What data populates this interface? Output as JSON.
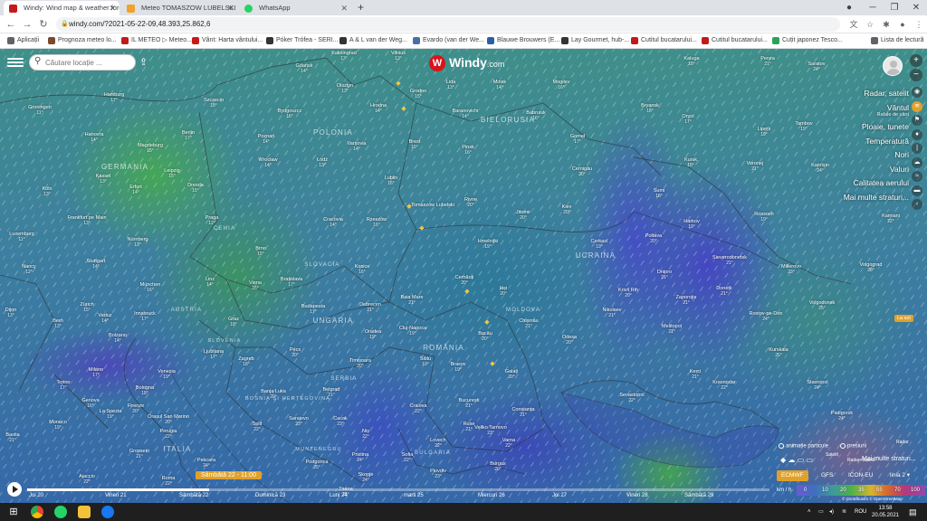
{
  "browser": {
    "tabs": [
      {
        "title": "Windy: Wind map & weather fore",
        "active": true,
        "favicon_color": "#c41a1a"
      },
      {
        "title": "Meteo TOMASZOW LUBELSKI (P",
        "active": false,
        "favicon_color": "#f0a22a"
      },
      {
        "title": "WhatsApp",
        "active": false,
        "favicon_color": "#25d366"
      }
    ],
    "new_tab_label": "+",
    "url": "windy.com/?2021-05-22-09,48.393,25.862,6",
    "bookmarks": [
      {
        "label": "Aplicații",
        "color": "#5f6368"
      },
      {
        "label": "Prognoza meteo lo...",
        "color": "#7b4a2a"
      },
      {
        "label": "IL METEO ▷ Meteo...",
        "color": "#c01a1a"
      },
      {
        "label": "Vânt: Harta vântului...",
        "color": "#c41a1a"
      },
      {
        "label": "Póker Trófea - SERI...",
        "color": "#333333"
      },
      {
        "label": "A & L van der Weg...",
        "color": "#333333"
      },
      {
        "label": "Evardo (van der We...",
        "color": "#4a6fa5"
      },
      {
        "label": "Blauwe Brouwers (E...",
        "color": "#2a5fa5"
      },
      {
        "label": "Lay Gourmet, hub-...",
        "color": "#333333"
      },
      {
        "label": "Cutitul bucatarului...",
        "color": "#c01a1a"
      },
      {
        "label": "Cutitul bucatarului...",
        "color": "#c01a1a"
      },
      {
        "label": "Cuțit japonez Tesco...",
        "color": "#2aa35a"
      }
    ],
    "reading_list": "Lista de lectură"
  },
  "windy": {
    "search_placeholder": "Căutare locație ...",
    "logo_text": "Windy",
    "logo_suffix": ".com",
    "layers": [
      {
        "label": "Radar, satelit"
      },
      {
        "label": "Vântul",
        "sub": "Rafale de vânt"
      },
      {
        "label": "Ploaie, tunete"
      },
      {
        "label": "Temperatură"
      },
      {
        "label": "Nori"
      },
      {
        "label": "Valuri"
      },
      {
        "label": "Calitatea aerului"
      },
      {
        "label": "Mai multe straturi..."
      }
    ],
    "la_sol": "La sol",
    "particles_label": "animație particule",
    "isobars_label": "presiuni",
    "overlay_options": [
      "Radar",
      "Satelit",
      "Radar+Satelit",
      "Mai multe straturi..."
    ],
    "models": [
      {
        "label": "ECMWF",
        "active": true
      },
      {
        "label": "GFS",
        "active": false
      },
      {
        "label": "ICON-EU",
        "active": false
      },
      {
        "label": "linia 2 ▾",
        "active": false
      }
    ],
    "legend_unit": "km / h",
    "legend_values": [
      "0",
      "10",
      "20",
      "35",
      "55",
      "70",
      "100"
    ],
    "attribution": "© Contributors © OpenStreetMap",
    "current_time": "Sâmbătă 22 - 11:00",
    "timeline_progress": 0.245,
    "days": [
      "Joi 20",
      "Vineri 21",
      "Sâmbătă 22",
      "Duminică 23",
      "Luni 24",
      "marti 25",
      "Miercuri 26",
      "Joi 27",
      "Vineri 28",
      "Sâmbătă 29"
    ]
  },
  "map": {
    "countries": [
      "GERMANIA",
      "POLONIA",
      "BIELORUSIA",
      "UCRAINA",
      "ROMÂNIA",
      "UNGARIA",
      "SLOVACIA",
      "CEHIA",
      "AUSTRIA",
      "MOLDOVA",
      "SERBIA",
      "BULGARIA",
      "ITALIA",
      "SLOVENIA",
      "BOSNIA ȘI HERȚEGOVINA",
      "MUNTENEGRU"
    ],
    "cities": [
      {
        "name": "Hamburg",
        "temp": "17°"
      },
      {
        "name": "Groningen",
        "temp": "11°"
      },
      {
        "name": "Berlin",
        "temp": "17°"
      },
      {
        "name": "Szczecin",
        "temp": "18°"
      },
      {
        "name": "Gdańsk",
        "temp": "14°"
      },
      {
        "name": "Olsztyn",
        "temp": "13°"
      },
      {
        "name": "Bydgoszcz",
        "temp": "16°"
      },
      {
        "name": "Poznań",
        "temp": "14°"
      },
      {
        "name": "Varșovia",
        "temp": "14°"
      },
      {
        "name": "Łódź",
        "temp": "13°"
      },
      {
        "name": "Wrocław",
        "temp": "14°"
      },
      {
        "name": "Lublin",
        "temp": "16°"
      },
      {
        "name": "Tomaszów Lubelski",
        "temp": ""
      },
      {
        "name": "Cracovia",
        "temp": "14°"
      },
      {
        "name": "Rzeszów",
        "temp": "16°"
      },
      {
        "name": "Brest",
        "temp": "15°"
      },
      {
        "name": "Grodno",
        "temp": "15°"
      },
      {
        "name": "Minsk",
        "temp": "14°"
      },
      {
        "name": "Baranovichi",
        "temp": "14°"
      },
      {
        "name": "Pinsk",
        "temp": "16°"
      },
      {
        "name": "Gomel",
        "temp": "17°"
      },
      {
        "name": "Mogilev",
        "temp": "16°"
      },
      {
        "name": "Bryansk",
        "temp": "18°"
      },
      {
        "name": "Oryol",
        "temp": "17°"
      },
      {
        "name": "Kursk",
        "temp": "18°"
      },
      {
        "name": "Rivne",
        "temp": "20°"
      },
      {
        "name": "Jitomir",
        "temp": "20°"
      },
      {
        "name": "Kiev",
        "temp": "20°"
      },
      {
        "name": "Cernigău",
        "temp": "20°"
      },
      {
        "name": "Sumi",
        "temp": "18°"
      },
      {
        "name": "Harkov",
        "temp": "19°"
      },
      {
        "name": "Poltava",
        "temp": "20°"
      },
      {
        "name": "Cerkasî",
        "temp": "19°"
      },
      {
        "name": "Hmelnițki",
        "temp": "19°"
      },
      {
        "name": "Cernăuți",
        "temp": "20°"
      },
      {
        "name": "Chișinău",
        "temp": "21°"
      },
      {
        "name": "Odesa",
        "temp": "20°"
      },
      {
        "name": "Nikolaev",
        "temp": "21°"
      },
      {
        "name": "Kriviî Rih",
        "temp": "20°"
      },
      {
        "name": "Dnipro",
        "temp": "21°"
      },
      {
        "name": "Zaporojie",
        "temp": "21°"
      },
      {
        "name": "Melitopol",
        "temp": "21°"
      },
      {
        "name": "Donețk",
        "temp": "21°"
      },
      {
        "name": "Rostov-pe-Don",
        "temp": "24°"
      },
      {
        "name": "Volgograd",
        "temp": "28°"
      },
      {
        "name": "Voronej",
        "temp": "21°"
      },
      {
        "name": "Lipețk",
        "temp": "19°"
      },
      {
        "name": "Krasnodar",
        "temp": "22°"
      },
      {
        "name": "Stavropol",
        "temp": "24°"
      },
      {
        "name": "Sevastopol",
        "temp": "22°"
      },
      {
        "name": "Kerci",
        "temp": "21°"
      },
      {
        "name": "Baia Mare",
        "temp": "21°"
      },
      {
        "name": "Cluj-Napoca",
        "temp": "19°"
      },
      {
        "name": "Debrecen",
        "temp": "21°"
      },
      {
        "name": "Budapesta",
        "temp": "17°"
      },
      {
        "name": "Bratislava",
        "temp": "17°"
      },
      {
        "name": "Viena",
        "temp": "16°"
      },
      {
        "name": "Praga",
        "temp": "12°"
      },
      {
        "name": "Brno",
        "temp": "15°"
      },
      {
        "name": "Kosice",
        "temp": "16°"
      },
      {
        "name": "Linz",
        "temp": "14°"
      },
      {
        "name": "München",
        "temp": "16°"
      },
      {
        "name": "Innsbruck",
        "temp": "17°"
      },
      {
        "name": "Graz",
        "temp": "18°"
      },
      {
        "name": "Ljubljana",
        "temp": "17°"
      },
      {
        "name": "Zagreb",
        "temp": "18°"
      },
      {
        "name": "Pécs",
        "temp": "20°"
      },
      {
        "name": "Timișoara",
        "temp": "20°"
      },
      {
        "name": "Belgrad",
        "temp": "21°"
      },
      {
        "name": "Sibiu",
        "temp": "19°"
      },
      {
        "name": "Brasov",
        "temp": "19°"
      },
      {
        "name": "Iași",
        "temp": "20°"
      },
      {
        "name": "Bacău",
        "temp": "20°"
      },
      {
        "name": "Galați",
        "temp": "20°"
      },
      {
        "name": "Constanța",
        "temp": "21°"
      },
      {
        "name": "București",
        "temp": "21°"
      },
      {
        "name": "Craiova",
        "temp": "22°"
      },
      {
        "name": "Varna",
        "temp": "22°"
      },
      {
        "name": "Burgas",
        "temp": "20°"
      },
      {
        "name": "Ruse",
        "temp": "21°"
      },
      {
        "name": "Sofia",
        "temp": "22°"
      },
      {
        "name": "Plovdiv",
        "temp": "23°"
      },
      {
        "name": "Niș",
        "temp": "22°"
      },
      {
        "name": "Cacak",
        "temp": "23°"
      },
      {
        "name": "Sarajevo",
        "temp": "23°"
      },
      {
        "name": "Banja Luka",
        "temp": "20°"
      },
      {
        "name": "Split",
        "temp": "22°"
      },
      {
        "name": "Podgorica",
        "temp": "25°"
      },
      {
        "name": "Skopje",
        "temp": "24°"
      },
      {
        "name": "Tirana",
        "temp": "25°"
      },
      {
        "name": "Venezia",
        "temp": "19°"
      },
      {
        "name": "Milano",
        "temp": "17°"
      },
      {
        "name": "Bologna",
        "temp": "18°"
      },
      {
        "name": "Torino",
        "temp": "17°"
      },
      {
        "name": "Genova",
        "temp": "16°"
      },
      {
        "name": "Firenze",
        "temp": "20°"
      },
      {
        "name": "Perugia",
        "temp": "22°"
      },
      {
        "name": "Roma",
        "temp": "22°"
      },
      {
        "name": "Pescara",
        "temp": "24°"
      },
      {
        "name": "Bern",
        "temp": "13°"
      },
      {
        "name": "Zürich",
        "temp": "15°"
      },
      {
        "name": "Stuttgart",
        "temp": "14°"
      },
      {
        "name": "Frankfurt pe Main",
        "temp": "13°"
      },
      {
        "name": "Nürnberg",
        "temp": "13°"
      },
      {
        "name": "Erfurt",
        "temp": "14°"
      },
      {
        "name": "Leipzig",
        "temp": "15°"
      },
      {
        "name": "Dresda",
        "temp": "15°"
      },
      {
        "name": "Hanovra",
        "temp": "14°"
      },
      {
        "name": "Magdeburg",
        "temp": "15°"
      },
      {
        "name": "Kassel",
        "temp": "13°"
      },
      {
        "name": "Köln",
        "temp": "13°"
      },
      {
        "name": "Luxemburg",
        "temp": "11°"
      },
      {
        "name": "Nancy",
        "temp": "12°"
      },
      {
        "name": "Dijon",
        "temp": "13°"
      },
      {
        "name": "Vaduz",
        "temp": "14°"
      },
      {
        "name": "Bolzano",
        "temp": "14°"
      },
      {
        "name": "La Spezia",
        "temp": "19°"
      },
      {
        "name": "Monaco",
        "temp": "19°"
      },
      {
        "name": "Bastia",
        "temp": "21°"
      },
      {
        "name": "Grosseto",
        "temp": "21°"
      },
      {
        "name": "Ajaccio",
        "temp": "22°"
      },
      {
        "name": "Orașul San Marino",
        "temp": "20°"
      },
      {
        "name": "Gomel",
        "temp": "17°"
      },
      {
        "name": "Kaliningrad",
        "temp": "13°"
      },
      {
        "name": "Vilnius",
        "temp": "13°"
      },
      {
        "name": "Lida",
        "temp": "13°"
      },
      {
        "name": "Hrodna",
        "temp": "14°"
      },
      {
        "name": "Babruisk",
        "temp": "16°"
      },
      {
        "name": "Kaluga",
        "temp": "18°"
      },
      {
        "name": "Saratov",
        "temp": "24°"
      },
      {
        "name": "Penza",
        "temp": "21°"
      },
      {
        "name": "Tambov",
        "temp": "19°"
      },
      {
        "name": "Rossosh",
        "temp": "19°"
      },
      {
        "name": "Kamîșin",
        "temp": "24°"
      },
      {
        "name": "Kamiani",
        "temp": "22°"
      },
      {
        "name": "Millerovo",
        "temp": "23°"
      },
      {
        "name": "Volgodonsk",
        "temp": "25°"
      },
      {
        "name": "Sieverodonetsk",
        "temp": "21°"
      },
      {
        "name": "Kurskaia",
        "temp": "25°"
      },
      {
        "name": "Piatigorsk",
        "temp": "24°"
      },
      {
        "name": "Lovech",
        "temp": "22°"
      },
      {
        "name": "Veliko Tarnovo",
        "temp": "23°"
      },
      {
        "name": "Pristina",
        "temp": "24°"
      },
      {
        "name": "Oradea",
        "temp": "19°"
      }
    ]
  },
  "taskbar": {
    "language": "ROU",
    "time": "13:58",
    "date": "20.05.2021"
  }
}
